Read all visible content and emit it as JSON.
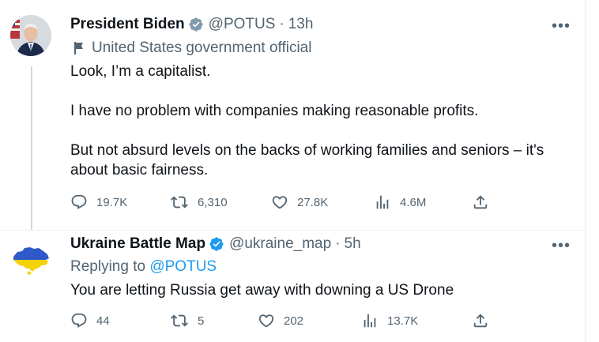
{
  "tweet1": {
    "author_name": "President Biden",
    "handle": "@POTUS",
    "separator": "·",
    "time": "13h",
    "label": "United States government official",
    "paragraphs": [
      "Look, I’m a capitalist.",
      "I have no problem with companies making reasonable profits.",
      "But not absurd levels on the backs of working families and seniors – it's",
      "about basic fairness."
    ],
    "stats": {
      "replies": "19.7K",
      "retweets": "6,310",
      "likes": "27.8K",
      "views": "4.6M"
    },
    "more": "•••"
  },
  "tweet2": {
    "author_name": "Ukraine Battle Map",
    "handle": "@ukraine_map",
    "separator": "·",
    "time": "5h",
    "replying_prefix": "Replying to",
    "replying_to": "@POTUS",
    "text": "You are letting Russia get away with downing a US Drone",
    "stats": {
      "replies": "44",
      "retweets": "5",
      "likes": "202",
      "views": "13.7K"
    },
    "more": "•••"
  },
  "colors": {
    "verified_gray": "#829aab",
    "verified_blue": "#1d9bf0",
    "link_blue": "#1d9bf0",
    "secondary_text": "#536471",
    "ukraine_blue": "#2d5ac8",
    "ukraine_yellow": "#f5d10a"
  },
  "icons": [
    "reply-icon",
    "retweet-icon",
    "like-icon",
    "views-icon",
    "share-icon",
    "flag-icon",
    "verified-badge-icon",
    "more-icon"
  ]
}
